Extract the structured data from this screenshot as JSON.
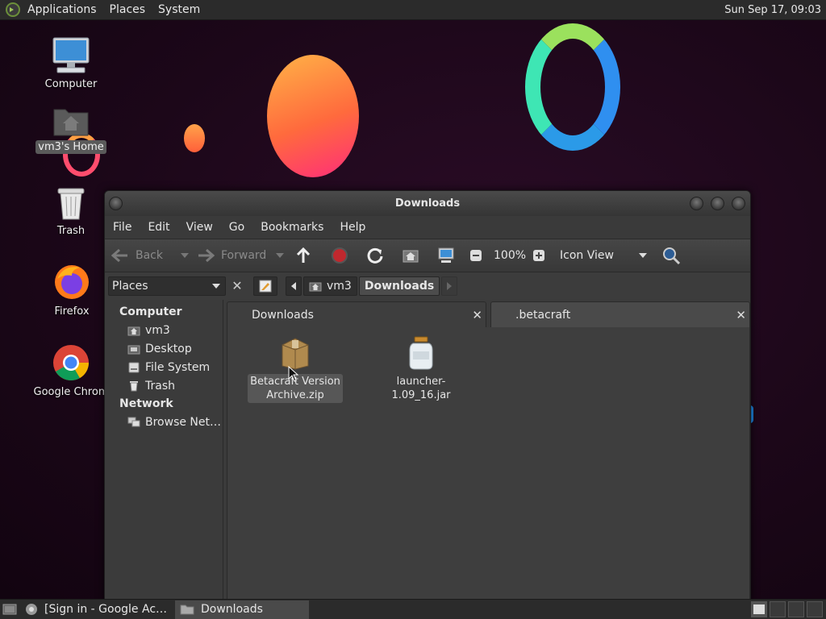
{
  "top_panel": {
    "menus": [
      "Applications",
      "Places",
      "System"
    ],
    "clock": "Sun Sep 17, 09:03"
  },
  "desktop": {
    "icons": [
      {
        "label": "Computer",
        "icon": "computer-icon"
      },
      {
        "label": "vm3's Home",
        "icon": "home-folder-icon",
        "selected": true
      },
      {
        "label": "Trash",
        "icon": "trash-icon"
      },
      {
        "label": "Firefox",
        "icon": "firefox-icon"
      },
      {
        "label": "Google Chrom",
        "icon": "chrome-icon"
      }
    ]
  },
  "window": {
    "title": "Downloads",
    "menubar": [
      "File",
      "Edit",
      "View",
      "Go",
      "Bookmarks",
      "Help"
    ],
    "toolbar": {
      "back": "Back",
      "forward": "Forward",
      "zoom": "100%",
      "view_mode": "Icon View"
    },
    "sidebar": {
      "selector": "Places",
      "computer_heading": "Computer",
      "computer_items": [
        "vm3",
        "Desktop",
        "File System",
        "Trash"
      ],
      "network_heading": "Network",
      "network_items": [
        "Browse Net…"
      ]
    },
    "breadcrumb": [
      "vm3",
      "Downloads"
    ],
    "tabs": [
      {
        "label": "Downloads",
        "active": true
      },
      {
        "label": ".betacraft",
        "active": false
      }
    ],
    "files": [
      {
        "name_line1": "Betacraft Version",
        "name_line2": "Archive.zip",
        "icon": "archive-icon",
        "selected": true
      },
      {
        "name_line1": "launcher-1.09_16.jar",
        "name_line2": "",
        "icon": "jar-icon",
        "selected": false
      }
    ]
  },
  "bottom_panel": {
    "tasks": [
      "[Sign in - Google Ac…",
      "Downloads"
    ]
  },
  "colors": {
    "panel_bg": "#2b2b2b",
    "window_bg": "#3c3c3c",
    "desktop_bg": "#1c0719"
  }
}
